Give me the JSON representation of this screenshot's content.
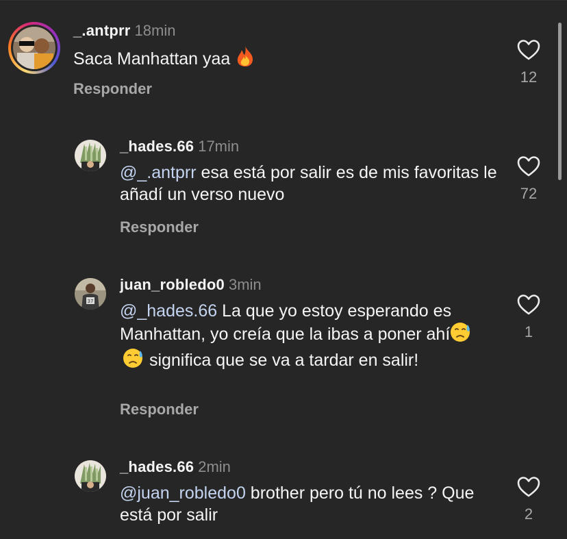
{
  "comments": [
    {
      "username": "_.antprr",
      "time": "18min",
      "text": "Saca Manhattan yaa",
      "reply_label": "Responder",
      "likes": "12",
      "avatar": "avatar-photo-two-kids"
    },
    {
      "username": "_hades.66",
      "time": "17min",
      "mention": "@_.antprr",
      "text": " esa está por salir es de mis favoritas le añadí un verso nuevo",
      "reply_label": "Responder",
      "likes": "72",
      "avatar": "avatar-photo-money-fan"
    },
    {
      "username": "juan_robledo0",
      "time": "3min",
      "mention": "@_hades.66",
      "text_part1": " La que yo estoy esperando es Manhattan, yo creía que la ibas a poner ahí",
      "text_part2": " significa que se va a tardar en salir!",
      "reply_label": "Responder",
      "likes": "1",
      "avatar": "avatar-photo-player"
    },
    {
      "username": "_hades.66",
      "time": "2min",
      "mention": "@juan_robledo0",
      "text": " brother pero tú no lees ? Que está por salir",
      "likes": "2",
      "avatar": "avatar-photo-money-fan"
    }
  ],
  "icons": {
    "heart": "heart-outline-icon",
    "fire": "fire-emoji",
    "sad": "sad-relieved-face-emoji"
  },
  "colors": {
    "background": "#262626",
    "mention": "#c4d4f0",
    "muted": "#8e8e8e"
  }
}
